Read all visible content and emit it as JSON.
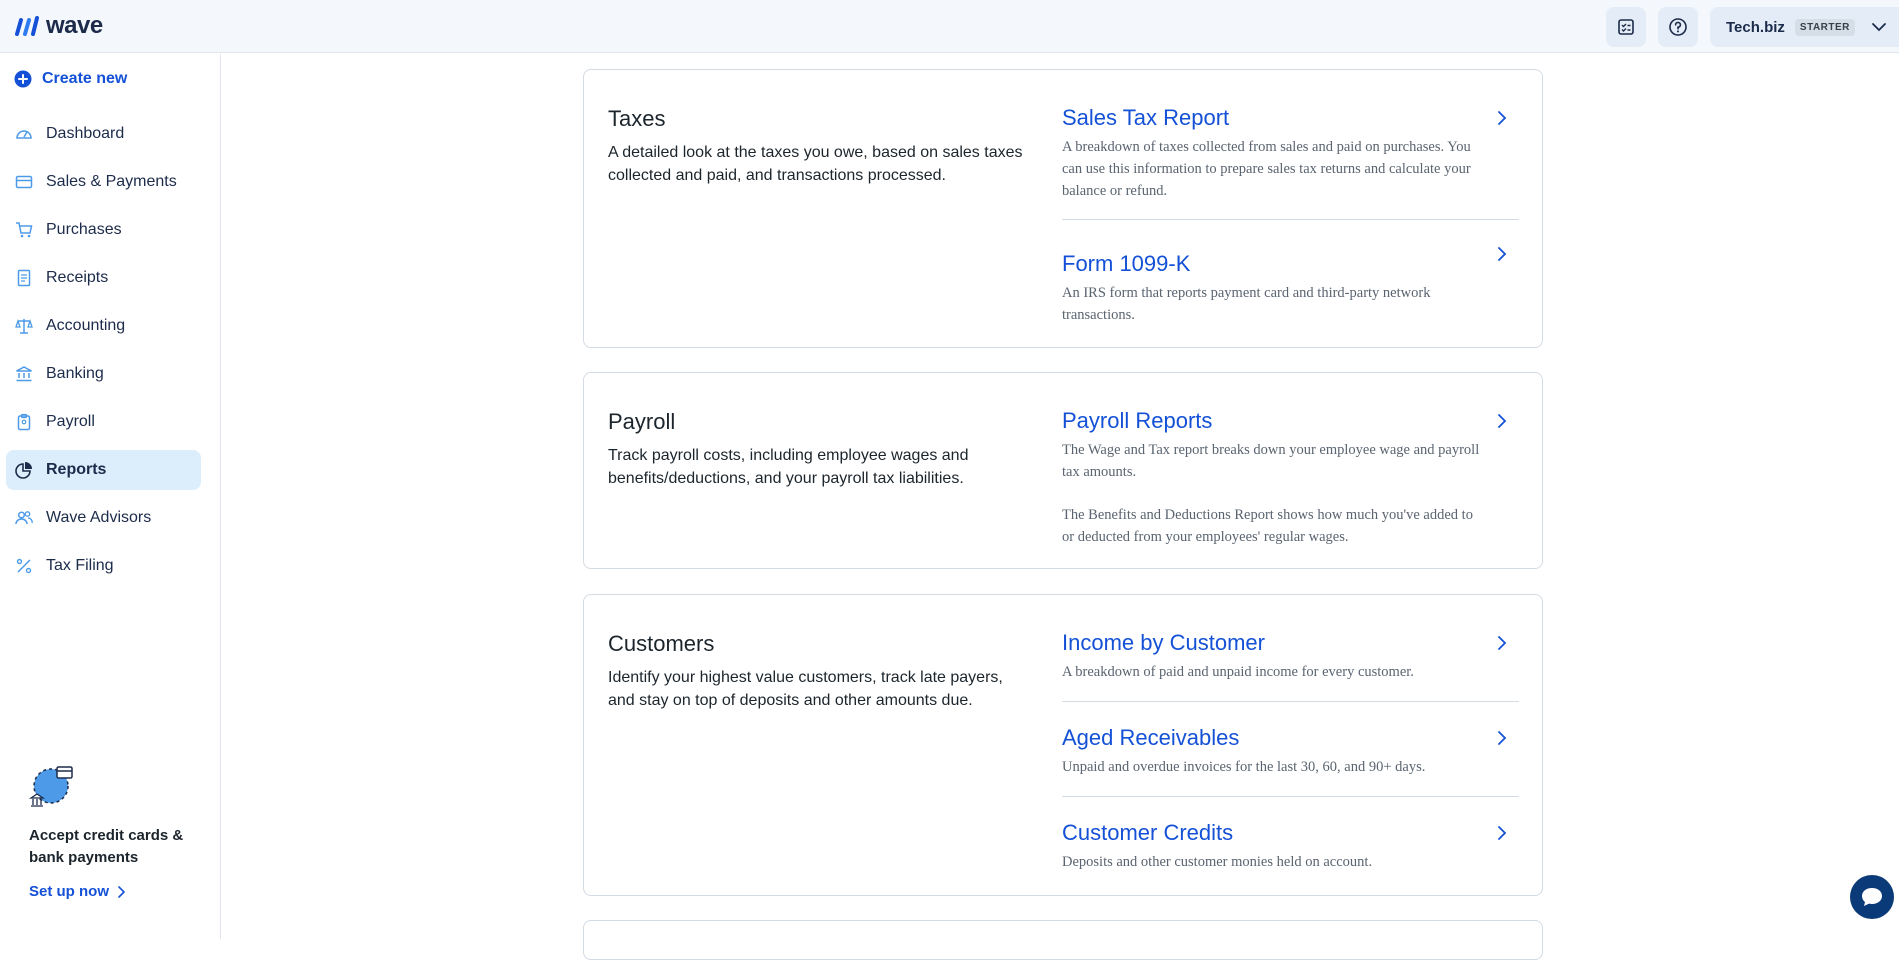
{
  "app": {
    "logo_text": "wave"
  },
  "header": {
    "business_name": "Tech.biz",
    "plan_badge": "STARTER"
  },
  "sidebar": {
    "create_new": "Create new",
    "items": [
      {
        "label": "Dashboard",
        "icon": "dashboard-icon"
      },
      {
        "label": "Sales & Payments",
        "icon": "card-icon"
      },
      {
        "label": "Purchases",
        "icon": "cart-icon"
      },
      {
        "label": "Receipts",
        "icon": "receipt-icon"
      },
      {
        "label": "Accounting",
        "icon": "scale-icon"
      },
      {
        "label": "Banking",
        "icon": "bank-icon"
      },
      {
        "label": "Payroll",
        "icon": "clipboard-icon"
      },
      {
        "label": "Reports",
        "icon": "pie-chart-icon",
        "active": true
      },
      {
        "label": "Wave Advisors",
        "icon": "people-icon"
      },
      {
        "label": "Tax Filing",
        "icon": "percent-icon"
      }
    ],
    "promo": {
      "title": "Accept credit cards & bank payments",
      "link": "Set up now"
    }
  },
  "sections": [
    {
      "title": "Taxes",
      "description": "A detailed look at the taxes you owe, based on sales taxes collected and paid, and transactions processed.",
      "reports": [
        {
          "title": "Sales Tax Report",
          "description": "A breakdown of taxes collected from sales and paid on purchases. You can use this information to prepare sales tax returns and calculate your balance or refund."
        },
        {
          "title": "Form 1099-K",
          "description": "An IRS form that reports payment card and third-party network transactions."
        }
      ]
    },
    {
      "title": "Payroll",
      "description": "Track payroll costs, including employee wages and benefits/deductions, and your payroll tax liabilities.",
      "reports": [
        {
          "title": "Payroll Reports",
          "description": "The Wage and Tax report breaks down your employee wage and payroll tax amounts.",
          "description_2": "The Benefits and Deductions Report shows how much you've added to or deducted from your employees' regular wages."
        }
      ]
    },
    {
      "title": "Customers",
      "description": "Identify your highest value customers, track late payers, and stay on top of deposits and other amounts due.",
      "reports": [
        {
          "title": "Income by Customer",
          "description": "A breakdown of paid and unpaid income for every customer."
        },
        {
          "title": "Aged Receivables",
          "description": "Unpaid and overdue invoices for the last 30, 60, and 90+ days."
        },
        {
          "title": "Customer Credits",
          "description": "Deposits and other customer monies held on account."
        }
      ]
    }
  ],
  "colors": {
    "brand_blue": "#1451d6",
    "active_nav_bg": "#dcedfb",
    "chat_button": "#0b3a78"
  }
}
